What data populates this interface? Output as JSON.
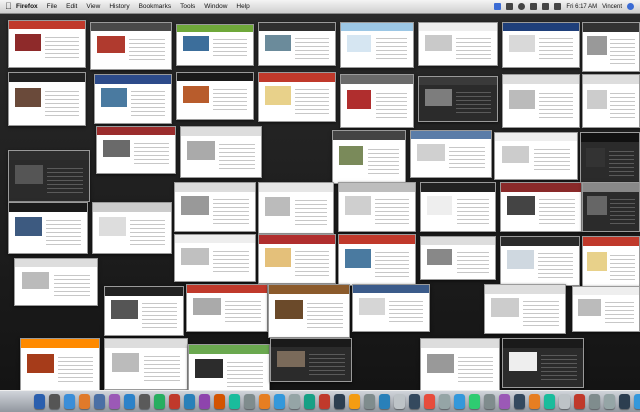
{
  "menubar": {
    "app": "Firefox",
    "items": [
      "File",
      "Edit",
      "View",
      "History",
      "Bookmarks",
      "Tools",
      "Window",
      "Help"
    ],
    "clock": "Fri 6:17 AM",
    "user": "Vincent"
  },
  "colors": {
    "desktop": "#1c1c1c",
    "menubar": "#dcdcdc",
    "dock": "#9aa0a8"
  },
  "expose": {
    "windows": [
      {
        "header": "#c0392b",
        "image": "#8e2a2a",
        "theme": "light"
      },
      {
        "header": "#4a4a4a",
        "image": "#b03a2e",
        "theme": "light"
      },
      {
        "header": "#6fa83a",
        "image": "#3c6e9b",
        "theme": "light"
      },
      {
        "header": "#2f2f2f",
        "image": "#6b8b9b",
        "theme": "light"
      },
      {
        "header": "#9cc7e5",
        "image": "#d6e6f2",
        "theme": "light"
      },
      {
        "header": "#eeeeee",
        "image": "#c9c9c9",
        "theme": "light"
      },
      {
        "header": "#1f3f7a",
        "image": "#d9d9d9",
        "theme": "light"
      },
      {
        "header": "#333333",
        "image": "#999999",
        "theme": "light"
      },
      {
        "header": "#222222",
        "image": "#6a4a3a",
        "theme": "light"
      },
      {
        "header": "#2d4b8a",
        "image": "#4a7aa0",
        "theme": "light"
      },
      {
        "header": "#1a1a1a",
        "image": "#b85c2c",
        "theme": "light"
      },
      {
        "header": "#c0392b",
        "image": "#e8d18a",
        "theme": "light"
      },
      {
        "header": "#6a6a6a",
        "image": "#b02e2e",
        "theme": "light"
      },
      {
        "header": "#3a3a3a",
        "image": "#7d7d7d",
        "theme": "dark"
      },
      {
        "header": "#dddddd",
        "image": "#bbbbbb",
        "theme": "light"
      },
      {
        "header": "#dddddd",
        "image": "#cccccc",
        "theme": "light"
      },
      {
        "header": "#2e2e2e",
        "image": "#555555",
        "theme": "dark"
      },
      {
        "header": "#9b2d2d",
        "image": "#6a6a6a",
        "theme": "light"
      },
      {
        "header": "#dddddd",
        "image": "#aaaaaa",
        "theme": "light"
      },
      {
        "header": "#444444",
        "image": "#7a8a5a",
        "theme": "light"
      },
      {
        "header": "#5a7ca8",
        "image": "#d0d0d0",
        "theme": "light"
      },
      {
        "header": "#eeeeee",
        "image": "#cccccc",
        "theme": "light"
      },
      {
        "header": "#111111",
        "image": "#333333",
        "theme": "dark"
      },
      {
        "header": "#dddddd",
        "image": "#999999",
        "theme": "light"
      },
      {
        "header": "#e6e6e6",
        "image": "#bbbbbb",
        "theme": "light"
      },
      {
        "header": "#bdbdbd",
        "image": "#cfcfcf",
        "theme": "light"
      },
      {
        "header": "#222222",
        "image": "#eeeeee",
        "theme": "light"
      },
      {
        "header": "#8a2a2a",
        "image": "#444444",
        "theme": "light"
      },
      {
        "header": "#888888",
        "image": "#666666",
        "theme": "dark"
      },
      {
        "header": "#1a1a1a",
        "image": "#3d5a80",
        "theme": "light"
      },
      {
        "header": "#cccccc",
        "image": "#dddddd",
        "theme": "light"
      },
      {
        "header": "#eeeeee",
        "image": "#c0c0c0",
        "theme": "light"
      },
      {
        "header": "#b02e2e",
        "image": "#e4c07a",
        "theme": "light"
      },
      {
        "header": "#c0392b",
        "image": "#4a7aa0",
        "theme": "light"
      },
      {
        "header": "#dddddd",
        "image": "#888888",
        "theme": "light"
      },
      {
        "header": "#2b2b2b",
        "image": "#cfd8e0",
        "theme": "light"
      },
      {
        "header": "#c0392b",
        "image": "#e8d18a",
        "theme": "light"
      },
      {
        "header": "#dddddd",
        "image": "#bbbbbb",
        "theme": "light"
      },
      {
        "header": "#222222",
        "image": "#555555",
        "theme": "light"
      },
      {
        "header": "#c0392b",
        "image": "#aaaaaa",
        "theme": "light"
      },
      {
        "header": "#8b5a2b",
        "image": "#6b4a2a",
        "theme": "light"
      },
      {
        "header": "#3b5b8a",
        "image": "#d6d6d6",
        "theme": "light"
      },
      {
        "header": "#dddddd",
        "image": "#cccccc",
        "theme": "light"
      },
      {
        "header": "#eeeeee",
        "image": "#bbbbbb",
        "theme": "light"
      },
      {
        "header": "#ff8a00",
        "image": "#a63c1a",
        "theme": "light"
      },
      {
        "header": "#dddddd",
        "image": "#bbbbbb",
        "theme": "light"
      },
      {
        "header": "#6aa84f",
        "image": "#2c2c2c",
        "theme": "light"
      },
      {
        "header": "#1a1a1a",
        "image": "#7a6a5a",
        "theme": "dark"
      },
      {
        "header": "#dddddd",
        "image": "#999999",
        "theme": "light"
      },
      {
        "header": "#1a1a1a",
        "image": "#eeeeee",
        "theme": "dark"
      },
      {
        "header": "#cccccc",
        "image": "#bbbbbb",
        "theme": "light"
      },
      {
        "header": "#c0392b",
        "image": "#dddddd",
        "theme": "light"
      },
      {
        "header": "#dddddd",
        "image": "#bbbbbb",
        "theme": "light"
      },
      {
        "header": "#2a2a2a",
        "image": "#7a1e1e",
        "theme": "dark"
      },
      {
        "header": "#a0522d",
        "image": "#d2b48c",
        "theme": "light"
      }
    ]
  },
  "dock": {
    "icons": [
      "#2b5fae",
      "#555555",
      "#3b8ed8",
      "#e07a2a",
      "#4a6fa5",
      "#9b59b6",
      "#2c82c9",
      "#5a5a5a",
      "#27ae60",
      "#c0392b",
      "#2980b9",
      "#8e44ad",
      "#d35400",
      "#1abc9c",
      "#7f8c8d",
      "#e67e22",
      "#3498db",
      "#95a5a6",
      "#16a085",
      "#c0392b",
      "#2c3e50",
      "#f39c12",
      "#7f8c8d",
      "#2980b9",
      "#bdc3c7",
      "#34495e",
      "#e74c3c",
      "#95a5a6",
      "#3498db",
      "#2ecc71",
      "#7f8c8d",
      "#9b59b6",
      "#34495e",
      "#e67e22",
      "#1abc9c",
      "#bdc3c7",
      "#c0392b",
      "#7f8c8d",
      "#95a5a6",
      "#2c3e50",
      "#3498db",
      "#e74c3c",
      "#f1c40f"
    ]
  }
}
